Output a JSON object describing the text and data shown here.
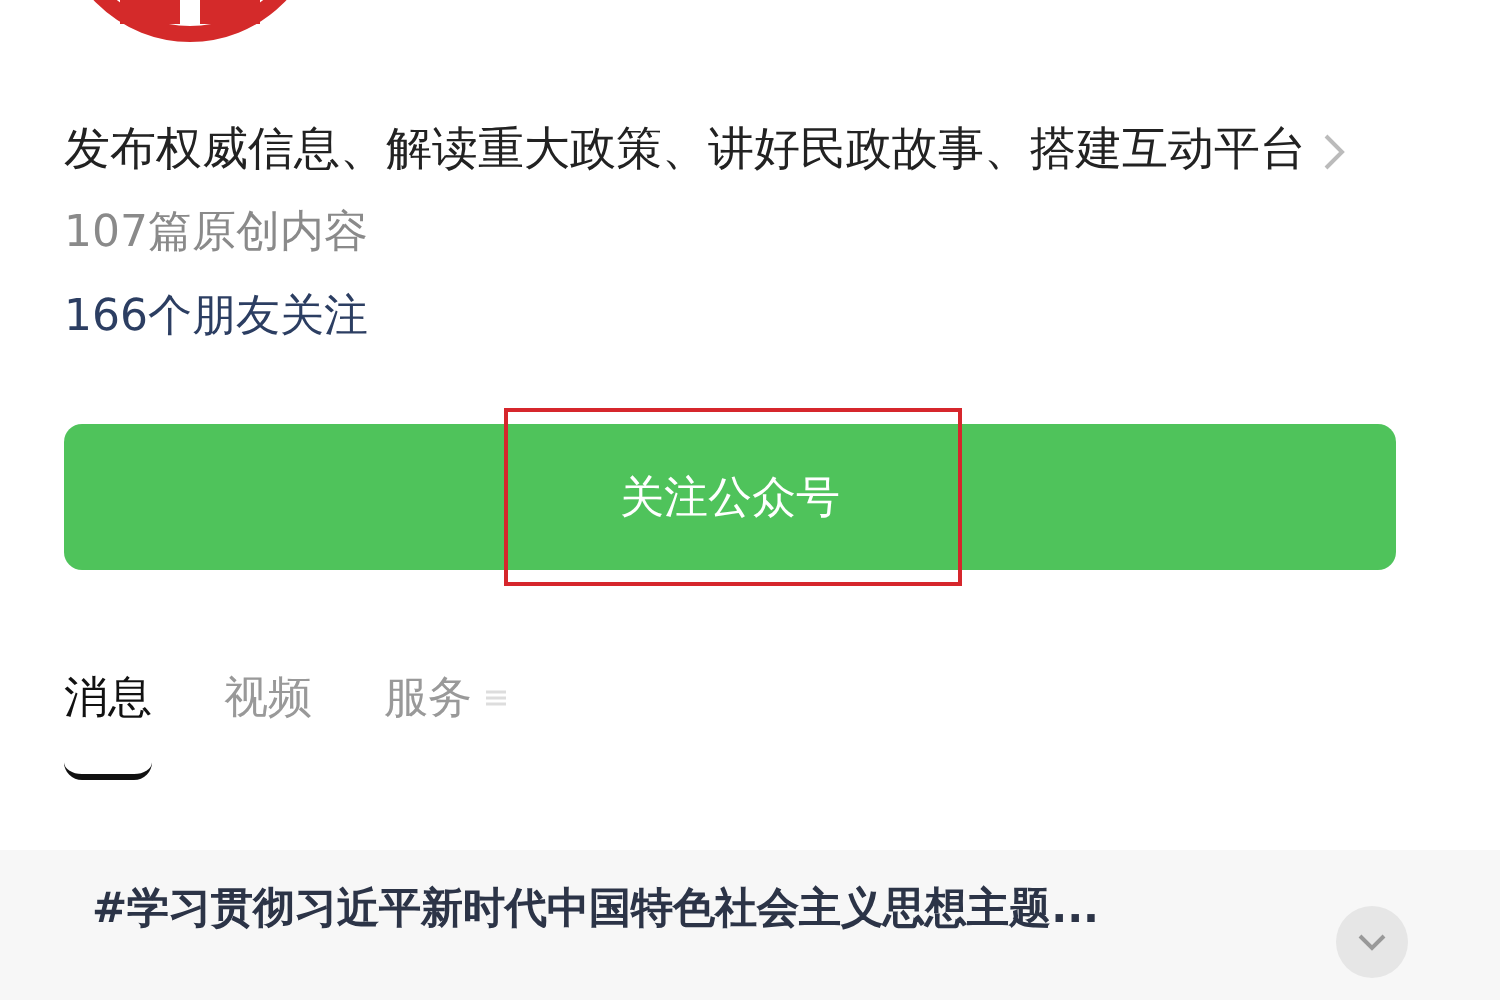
{
  "description": "发布权威信息、解读重大政策、讲好民政故事、搭建互动平台",
  "original_count": "107篇原创内容",
  "friends_following": "166个朋友关注",
  "follow_button": {
    "label": "关注公众号",
    "highlighted": true
  },
  "tabs": [
    {
      "label": "消息",
      "selected": true
    },
    {
      "label": "视频",
      "selected": false
    },
    {
      "label": "服务",
      "selected": false,
      "kind": "menu"
    }
  ],
  "articles": [
    {
      "title": "#学习贯彻习近平新时代中国特色社会主义思想主题..."
    }
  ]
}
